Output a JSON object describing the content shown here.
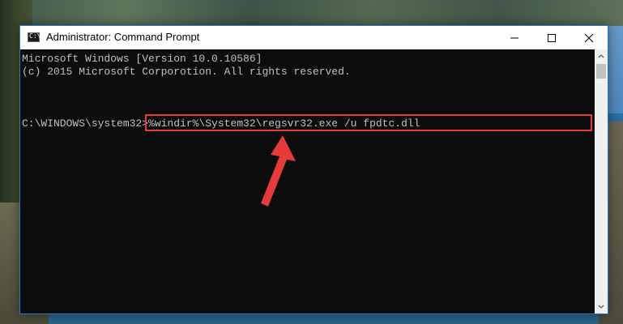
{
  "window": {
    "title": "Administrator: Command Prompt",
    "title_icon": "cmd-icon",
    "border_color": "#2b78c2",
    "controls": {
      "minimize": "minimize-icon",
      "maximize": "maximize-icon",
      "close": "close-icon"
    }
  },
  "console": {
    "background": "#0c0c0c",
    "text_color": "#c0c0c0",
    "lines": [
      "Microsoft Windows [Version 10.0.10586]",
      "(c) 2015 Microsoft Corporotion. All rights reserved."
    ],
    "prompt": "C:\\WINDOWS\\system32>",
    "command": "%windir%\\System32\\regsvr32.exe /u fpdtc.dll"
  },
  "annotation": {
    "highlight_color": "#e53b3b",
    "arrow_icon": "arrow-pointer-icon"
  },
  "scrollbar": {
    "up_icon": "scroll-up-icon",
    "down_icon": "scroll-down-icon"
  }
}
